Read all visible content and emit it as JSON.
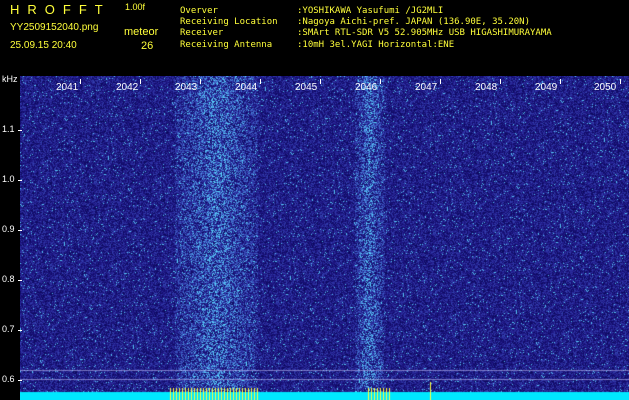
{
  "header": {
    "logo": "HROFFT",
    "version": "1.00f",
    "filename": "YY2509152040.png",
    "meteor_label": "meteor",
    "meteor_count": "26",
    "datetime": "25.09.15 20:40",
    "info": [
      {
        "key": "Overver",
        "value": ":YOSHIKAWA Yasufumi /JG2MLI"
      },
      {
        "key": "Receiving Location",
        "value": ":Nagoya Aichi-pref. JAPAN (136.90E, 35.20N)"
      },
      {
        "key": "Receiver",
        "value": ":SMArt RTL-SDR V5 52.905MHz USB HIGASHIMURAYAMA"
      },
      {
        "key": "Receiving Antenna",
        "value": ":10mH 3el.YAGI Horizontal:ENE"
      }
    ]
  },
  "axes": {
    "y_unit": "kHz",
    "x_ticks": [
      "2041",
      "2042",
      "2043",
      "2044",
      "2045",
      "2046",
      "2047",
      "2048",
      "2049",
      "2050"
    ],
    "y_ticks": [
      "1.1",
      "1.0",
      "0.9",
      "0.8",
      "0.7",
      "0.6"
    ]
  },
  "colors": {
    "background": "#000000",
    "label_yellow": "#ffff3a",
    "waterfall_base": "#0a0a7a",
    "waterfall_bright": "#40c8ff",
    "meteor_marker": "#ffff3a",
    "baseline_cyan": "#00e8ff"
  },
  "chart_data": {
    "type": "heatmap",
    "xlabel": "",
    "ylabel": "kHz",
    "x_categories": [
      "2041",
      "2042",
      "2043",
      "2044",
      "2045",
      "2046",
      "2047",
      "2048",
      "2049",
      "2050"
    ],
    "y_ticks": [
      1.1,
      1.0,
      0.9,
      0.8,
      0.7,
      0.6
    ],
    "bright_bands_x": [
      [
        2042.9,
        2044.3
      ],
      [
        2045.9,
        2046.4
      ]
    ],
    "meteor_count": 26
  }
}
